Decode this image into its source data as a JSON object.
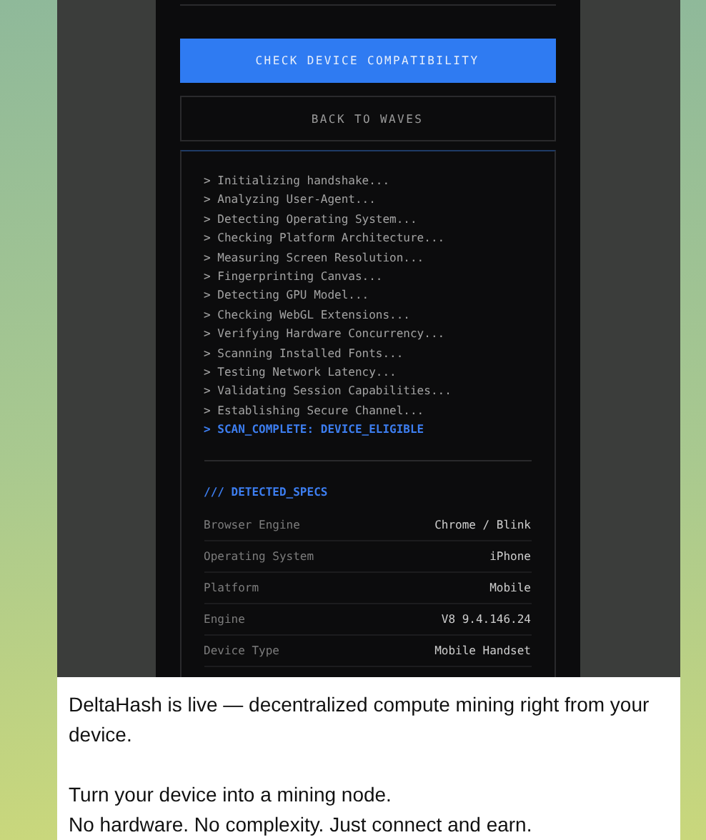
{
  "screenshot": {
    "action_buttons": [
      {
        "label": "CHECK DEVICE COMPATIBILITY",
        "kind": "primary"
      },
      {
        "label": "BACK TO WAVES",
        "kind": "secondary"
      }
    ],
    "log_lines": [
      {
        "text": "> Initializing handshake...",
        "kind": "step"
      },
      {
        "text": "> Analyzing User-Agent...",
        "kind": "step"
      },
      {
        "text": "> Detecting Operating System...",
        "kind": "step"
      },
      {
        "text": "> Checking Platform Architecture...",
        "kind": "step"
      },
      {
        "text": "> Measuring Screen Resolution...",
        "kind": "step"
      },
      {
        "text": "> Fingerprinting Canvas...",
        "kind": "step"
      },
      {
        "text": "> Detecting GPU Model...",
        "kind": "step"
      },
      {
        "text": "> Checking WebGL Extensions...",
        "kind": "step"
      },
      {
        "text": "> Verifying Hardware Concurrency...",
        "kind": "step"
      },
      {
        "text": "> Scanning Installed Fonts...",
        "kind": "step"
      },
      {
        "text": "> Testing Network Latency...",
        "kind": "step"
      },
      {
        "text": "> Validating Session Capabilities...",
        "kind": "step"
      },
      {
        "text": "> Establishing Secure Channel...",
        "kind": "step"
      },
      {
        "text": "> SCAN_COMPLETE: DEVICE_ELIGIBLE",
        "kind": "complete"
      }
    ],
    "specs_title": "/// DETECTED_SPECS",
    "specs": [
      {
        "label": "Browser Engine",
        "value": "Chrome / Blink"
      },
      {
        "label": "Operating System",
        "value": "iPhone"
      },
      {
        "label": "Platform",
        "value": "Mobile"
      },
      {
        "label": "Engine",
        "value": "V8 9.4.146.24"
      },
      {
        "label": "Device Type",
        "value": "Mobile Handset"
      }
    ]
  },
  "message": {
    "paragraphs": [
      [
        "DeltaHash is live — decentralized compute mining right from your device."
      ],
      [
        "Turn your device into a mining node.",
        "No hardware. No complexity. Just connect and earn."
      ]
    ]
  }
}
